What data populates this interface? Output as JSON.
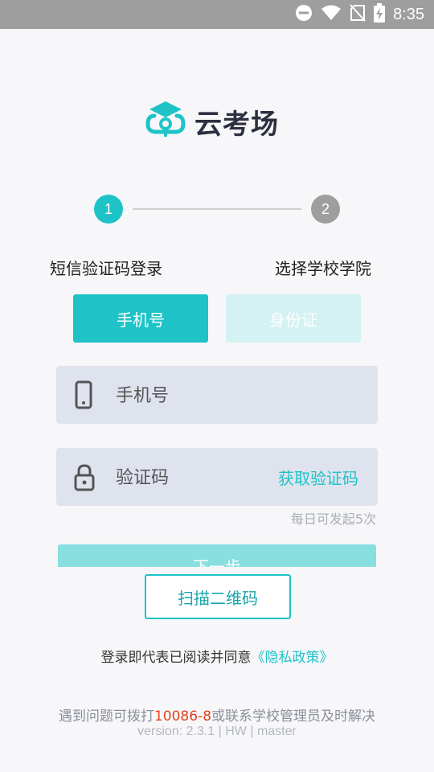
{
  "status_bar": {
    "time": "8:35"
  },
  "app": {
    "name": "云考场"
  },
  "stepper": {
    "step1_number": "1",
    "step2_number": "2",
    "step1_label": "短信验证码登录",
    "step2_label": "选择学校学院",
    "active_color": "#1ec3c8",
    "inactive_color": "#9e9e9e"
  },
  "login_tabs": {
    "phone_label": "手机号",
    "idcard_label": "身份证"
  },
  "form": {
    "phone_placeholder": "手机号",
    "code_placeholder": "验证码",
    "get_code_label": "获取验证码",
    "daily_limit_text": "每日可发起5次"
  },
  "buttons": {
    "next_label": "下一步",
    "scan_label": "扫描二维码"
  },
  "agreement": {
    "prefix": "登录即代表已阅读并同意",
    "link": "《隐私政策》"
  },
  "footer": {
    "help_prefix": "遇到问题可拨打",
    "help_phone": "10086-8",
    "help_suffix": "或联系学校管理员及时解决",
    "version": "version: 2.3.1 | HW | master"
  },
  "colors": {
    "accent": "#1ec3c8",
    "accent_light": "#d4f2f3",
    "error_phone": "#e0441e"
  }
}
